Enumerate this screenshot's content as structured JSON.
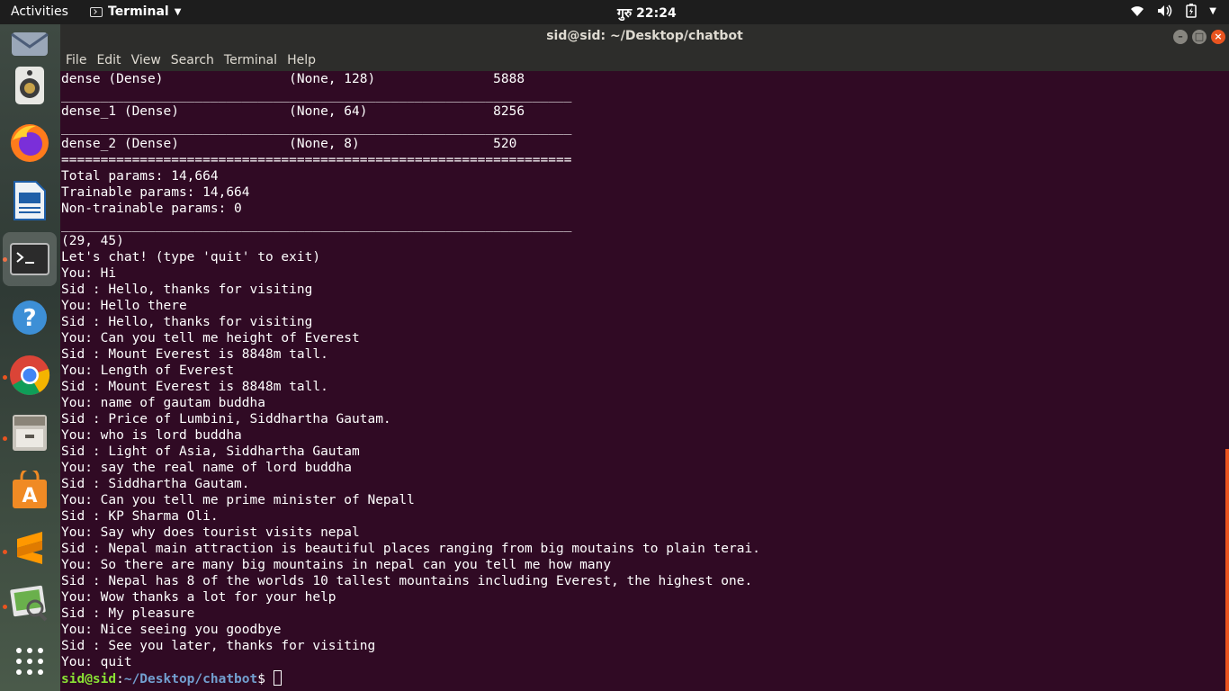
{
  "topbar": {
    "activities": "Activities",
    "app_name": "Terminal",
    "clock": "गुरु 22:24",
    "tray_icons": [
      "wifi-icon",
      "volume-icon",
      "battery-icon",
      "power-menu-icon"
    ]
  },
  "dock": {
    "items": [
      {
        "name": "thunderbird",
        "icon": "mail-icon"
      },
      {
        "name": "rhythmbox",
        "icon": "speaker-icon"
      },
      {
        "name": "firefox",
        "icon": "firefox-icon"
      },
      {
        "name": "libreoffice-writer",
        "icon": "document-icon"
      },
      {
        "name": "terminal",
        "icon": "terminal-icon",
        "active": true
      },
      {
        "name": "help",
        "icon": "help-icon"
      },
      {
        "name": "chrome",
        "icon": "chrome-icon"
      },
      {
        "name": "files",
        "icon": "file-cabinet-icon"
      },
      {
        "name": "software",
        "icon": "shopping-bag-icon"
      },
      {
        "name": "sublime-text",
        "icon": "sublime-icon"
      },
      {
        "name": "image-viewer",
        "icon": "image-search-icon"
      },
      {
        "name": "show-applications",
        "icon": "app-grid-icon"
      }
    ]
  },
  "window": {
    "title": "sid@sid: ~/Desktop/chatbot",
    "menu": [
      "File",
      "Edit",
      "View",
      "Search",
      "Terminal",
      "Help"
    ]
  },
  "terminal": {
    "lines": [
      "dense (Dense)                (None, 128)               5888",
      "_________________________________________________________________",
      "dense_1 (Dense)              (None, 64)                8256",
      "_________________________________________________________________",
      "dense_2 (Dense)              (None, 8)                 520",
      "=================================================================",
      "Total params: 14,664",
      "Trainable params: 14,664",
      "Non-trainable params: 0",
      "_________________________________________________________________",
      "(29, 45)",
      "Let's chat! (type 'quit' to exit)",
      "You: Hi",
      "Sid : Hello, thanks for visiting",
      "You: Hello there",
      "Sid : Hello, thanks for visiting",
      "You: Can you tell me height of Everest",
      "Sid : Mount Everest is 8848m tall.",
      "You: Length of Everest",
      "Sid : Mount Everest is 8848m tall.",
      "You: name of gautam buddha",
      "Sid : Price of Lumbini, Siddhartha Gautam.",
      "You: who is lord buddha",
      "Sid : Light of Asia, Siddhartha Gautam",
      "You: say the real name of lord buddha",
      "Sid : Siddhartha Gautam.",
      "You: Can you tell me prime minister of Nepall",
      "Sid : KP Sharma Oli.",
      "You: Say why does tourist visits nepal",
      "Sid : Nepal main attraction is beautiful places ranging from big moutains to plain terai.",
      "You: So there are many big mountains in nepal can you tell me how many",
      "Sid : Nepal has 8 of the worlds 10 tallest mountains including Everest, the highest one.",
      "You: Wow thanks a lot for your help",
      "Sid : My pleasure",
      "You: Nice seeing you goodbye",
      "Sid : See you later, thanks for visiting",
      "You: quit"
    ],
    "prompt_user": "sid@sid",
    "prompt_sep": ":",
    "prompt_path": "~/Desktop/chatbot",
    "prompt_symbol": "$ "
  }
}
